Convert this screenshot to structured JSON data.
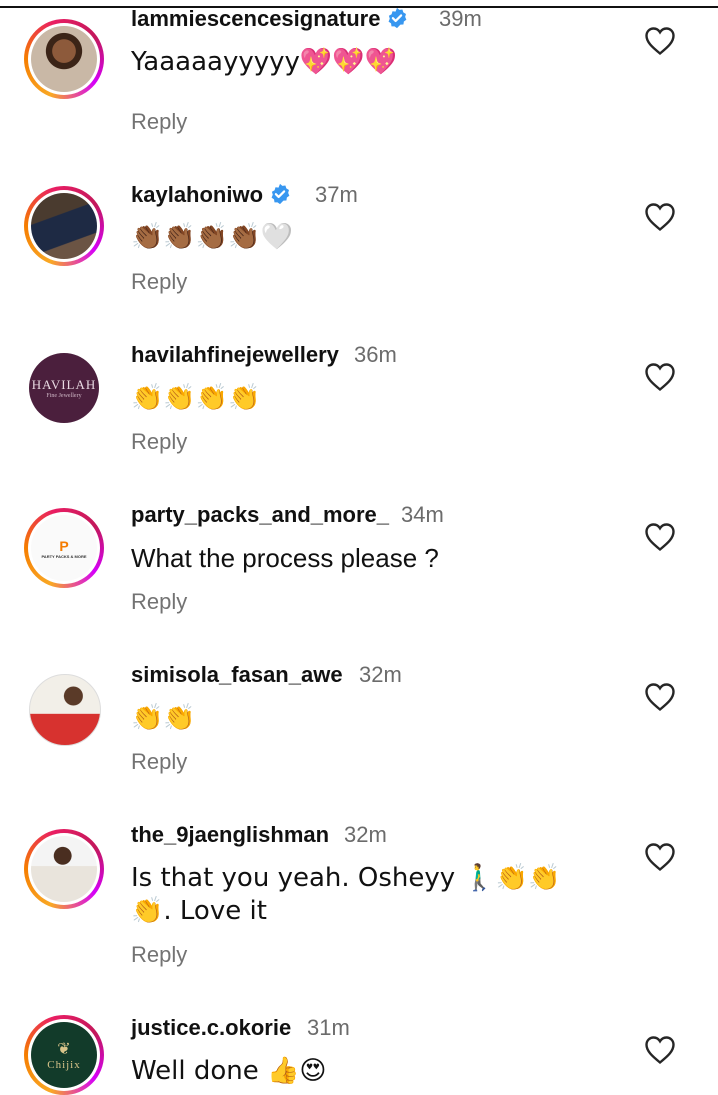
{
  "comments": [
    {
      "username": "lammiescencesignature",
      "verified": true,
      "time": "39m",
      "text": "Yaaaaayyyyy💖💖💖",
      "reply": "Reply"
    },
    {
      "username": "kaylahoniwo",
      "verified": true,
      "time": "37m",
      "text": "👏🏾👏🏾👏🏾👏🏾🤍",
      "reply": "Reply"
    },
    {
      "username": "havilahfinejewellery",
      "verified": false,
      "time": "36m",
      "text": "👏👏👏👏",
      "reply": "Reply",
      "avatar_text": "HAVILAH",
      "avatar_sub": "Fine Jewellery"
    },
    {
      "username": "party_packs_and_more_",
      "verified": false,
      "time": "34m",
      "text": "What the process please ?",
      "reply": "Reply",
      "avatar_text": "PARTY PACKS & MORE"
    },
    {
      "username": "simisola_fasan_awe",
      "verified": false,
      "time": "32m",
      "text": "👏👏",
      "reply": "Reply"
    },
    {
      "username": "the_9jaenglishman",
      "verified": false,
      "time": "32m",
      "text": "Is that you yeah.  Osheyy 🚶‍♂️👏👏👏. Love it",
      "reply": "Reply"
    },
    {
      "username": "justice.c.okorie",
      "verified": false,
      "time": "31m",
      "text": "Well done 👍😍",
      "reply": "Reply",
      "avatar_text": "Chijix"
    }
  ],
  "colors": {
    "verified": "#3897f0",
    "reply": "#737373",
    "time": "#6b6b6b"
  }
}
